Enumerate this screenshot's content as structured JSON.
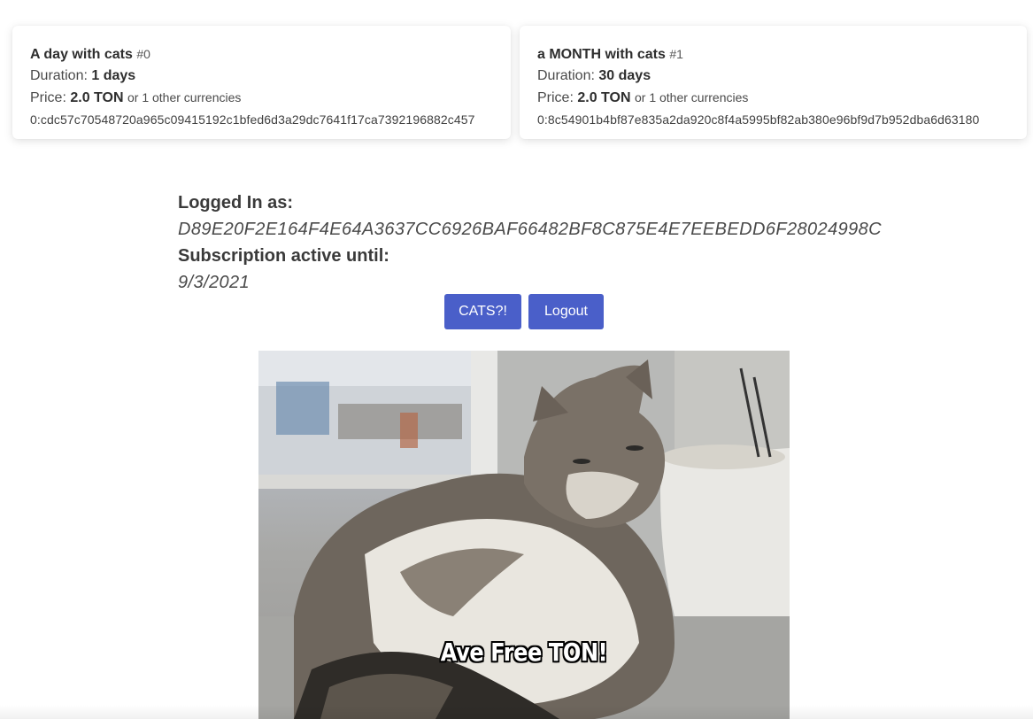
{
  "plans": [
    {
      "name": "A day with cats",
      "index": "#0",
      "duration_label": "Duration:",
      "duration_value": "1 days",
      "price_label": "Price:",
      "price_value": "2.0 TON",
      "price_other": "or 1 other currencies",
      "address": "0:cdc57c70548720a965c09415192c1bfed6d3a29dc7641f17ca7392196882c457"
    },
    {
      "name": "a MONTH with cats",
      "index": "#1",
      "duration_label": "Duration:",
      "duration_value": "30 days",
      "price_label": "Price:",
      "price_value": "2.0 TON",
      "price_other": "or 1 other currencies",
      "address": "0:8c54901b4bf87e835a2da920c8f4a5995bf82ab380e96bf9d7b952dba6d63180"
    }
  ],
  "session": {
    "logged_in_label": "Logged In as:",
    "user_key": "D89E20F2E164F4E64A3637CC6926BAF66482BF8C875E4E7EEBEDD6F28024998C",
    "subscription_label": "Subscription active until:",
    "subscription_date": "9/3/2021"
  },
  "buttons": {
    "cats_label": "CATS?!",
    "logout_label": "Logout"
  },
  "photo": {
    "caption": "Ave Free TON!"
  },
  "colors": {
    "button": "#4a5fc9",
    "text": "#3a3a3a"
  }
}
